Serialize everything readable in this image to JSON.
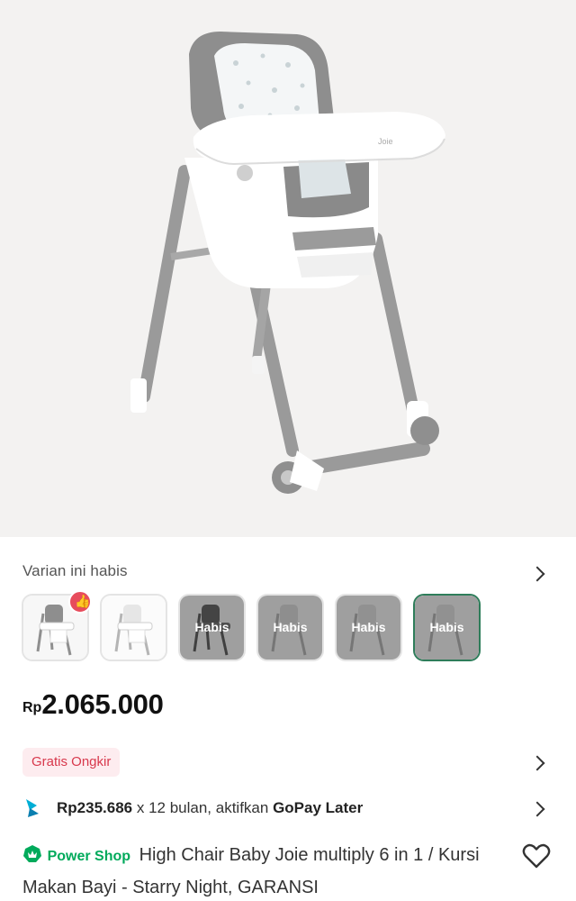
{
  "product": {
    "image_alt": "Joie multiply high chair, grey with white tray",
    "tray_brand": "Joie"
  },
  "variants": {
    "label": "Varian ini habis",
    "items": [
      {
        "status": "",
        "has_like_badge": true
      },
      {
        "status": ""
      },
      {
        "status": "Habis"
      },
      {
        "status": "Habis"
      },
      {
        "status": "Habis"
      },
      {
        "status": "Habis",
        "selected": true
      }
    ]
  },
  "price": {
    "currency": "Rp",
    "amount": "2.065.000"
  },
  "shipping": {
    "badge": "Gratis Ongkir"
  },
  "installment": {
    "amount": "Rp235.686",
    "terms": " x 12 bulan, aktifkan ",
    "provider": "GoPay Later"
  },
  "title": {
    "shop_badge": "Power Shop",
    "text": "High Chair Baby Joie multiply 6 in 1 / Kursi Makan Bayi - Starry Night, GARANSI"
  },
  "colors": {
    "accent_green": "#00aa5b",
    "promo_red": "#d8384c",
    "selected_border": "#2e7d5a"
  },
  "icons": [
    "thumb-up-icon",
    "chevron-right-icon",
    "gopay-later-icon",
    "power-shop-icon",
    "heart-outline-icon"
  ]
}
